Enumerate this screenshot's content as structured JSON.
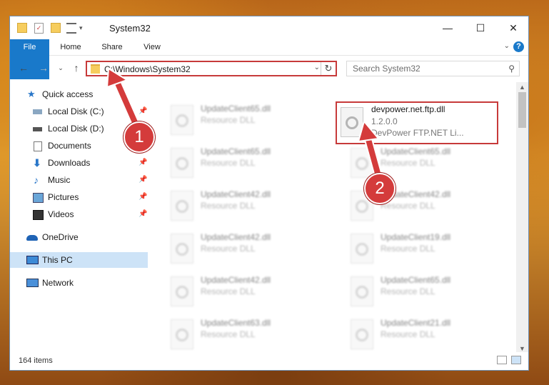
{
  "window": {
    "title": "System32"
  },
  "ribbon": {
    "tabs": [
      "File",
      "Home",
      "Share",
      "View"
    ],
    "help": "?"
  },
  "nav": {
    "address": "C:\\Windows\\System32",
    "search_placeholder": "Search System32"
  },
  "sidebar": {
    "items": [
      {
        "label": "Quick access",
        "icon": "star-icon"
      },
      {
        "label": "Local Disk (C:)",
        "icon": "drive-icon",
        "pinned": true
      },
      {
        "label": "Local Disk (D:)",
        "icon": "drive-icon",
        "pinned": false
      },
      {
        "label": "Documents",
        "icon": "documents-icon",
        "pinned": true
      },
      {
        "label": "Downloads",
        "icon": "download-icon",
        "pinned": true
      },
      {
        "label": "Music",
        "icon": "music-icon",
        "pinned": true
      },
      {
        "label": "Pictures",
        "icon": "pictures-icon",
        "pinned": true
      },
      {
        "label": "Videos",
        "icon": "videos-icon",
        "pinned": true
      },
      {
        "label": "OneDrive",
        "icon": "cloud-icon"
      },
      {
        "label": "This PC",
        "icon": "pc-icon",
        "selected": true
      },
      {
        "label": "Network",
        "icon": "network-icon"
      }
    ]
  },
  "files": {
    "highlighted": {
      "name": "devpower.net.ftp.dll",
      "version": "1.2.0.0",
      "description": "DevPower FTP.NET Li..."
    },
    "left_column": [
      {
        "name": "UpdateClient65.dll",
        "type": "Resource DLL"
      },
      {
        "name": "UpdateClient65.dll",
        "type": "Resource DLL"
      },
      {
        "name": "UpdateClient42.dll",
        "type": "Resource DLL"
      },
      {
        "name": "UpdateClient42.dll",
        "type": "Resource DLL"
      },
      {
        "name": "UpdateClient42.dll",
        "type": "Resource DLL"
      },
      {
        "name": "UpdateClient63.dll",
        "type": "Resource DLL"
      }
    ],
    "right_column": [
      {
        "name": "UpdateClient65.dll",
        "type": "Resource DLL"
      },
      {
        "name": "UpdateClient42.dll",
        "type": "Resource DLL"
      },
      {
        "name": "UpdateClient19.dll",
        "type": "Resource DLL"
      },
      {
        "name": "UpdateClient65.dll",
        "type": "Resource DLL"
      },
      {
        "name": "UpdateClient21.dll",
        "type": "Resource DLL"
      }
    ]
  },
  "status": {
    "count": "164 items"
  },
  "annotations": {
    "step1": "1",
    "step2": "2"
  },
  "colors": {
    "accent": "#1979ca",
    "highlight": "#c73a3a",
    "selected": "#cde3f7"
  }
}
